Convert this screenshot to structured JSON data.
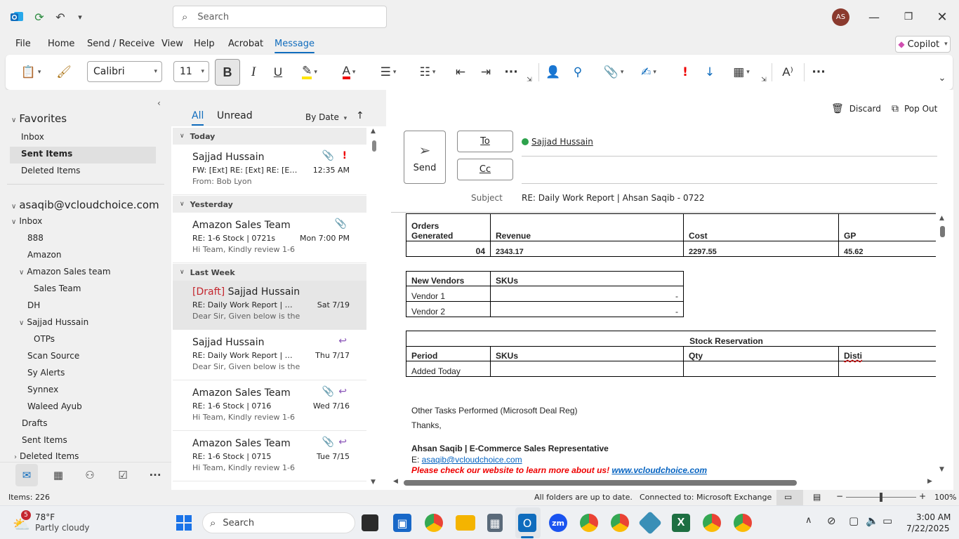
{
  "titlebar": {
    "search_placeholder": "Search",
    "avatar_initials": "AS"
  },
  "menu": {
    "file": "File",
    "home": "Home",
    "send_receive": "Send / Receive",
    "view": "View",
    "help": "Help",
    "acrobat": "Acrobat",
    "message": "Message",
    "copilot": "Copilot"
  },
  "ribbon": {
    "font": "Calibri",
    "size": "11"
  },
  "nav": {
    "favorites": "Favorites",
    "fav_items": [
      "Inbox",
      "Sent Items",
      "Deleted Items"
    ],
    "account": "asaqib@vcloudchoice.com",
    "inbox": "Inbox",
    "sub": [
      "888",
      "Amazon",
      "Amazon Sales team",
      "Sales Team",
      "DH",
      "Sajjad Hussain",
      "OTPs",
      "Scan Source",
      "Sy Alerts",
      "Synnex",
      "Waleed Ayub"
    ],
    "drafts": "Drafts",
    "sent": "Sent Items",
    "deleted": "Deleted Items"
  },
  "list": {
    "tab_all": "All",
    "tab_unread": "Unread",
    "sort": "By Date",
    "groups": [
      "Today",
      "Yesterday",
      "Last Week"
    ],
    "items": [
      {
        "sender": "Sajjad Hussain",
        "subject": "FW: [Ext] RE: [Ext] RE: [Ext] R...",
        "preview": "From: Bob Lyon",
        "date": "12:35 AM"
      },
      {
        "sender": "Amazon Sales Team",
        "subject": "RE: 1-6 Stock | 0721s",
        "preview": "Hi Team,  Kindly review 1-6",
        "date": "Mon 7:00 PM"
      },
      {
        "draft": "[Draft]",
        "sender": "Sajjad Hussain",
        "subject": "RE: Daily Work Report | Ah...",
        "preview": "Dear Sir,  Given below is the",
        "date": "Sat 7/19"
      },
      {
        "sender": "Sajjad Hussain",
        "subject": "RE: Daily Work Report | Ah...",
        "preview": "Dear Sir,  Given below is the",
        "date": "Thu 7/17"
      },
      {
        "sender": "Amazon Sales Team",
        "subject": "RE: 1-6 Stock | 0716",
        "preview": "Hi Team,  Kindly review 1-6",
        "date": "Wed 7/16"
      },
      {
        "sender": "Amazon Sales Team",
        "subject": "RE: 1-6 Stock | 0715",
        "preview": "Hi Team,  Kindly review 1-6",
        "date": "Tue 7/15"
      }
    ]
  },
  "compose": {
    "discard": "Discard",
    "popout": "Pop Out",
    "send": "Send",
    "to": "To",
    "cc": "Cc",
    "to_recipient": "Sajjad Hussain",
    "subject_label": "Subject",
    "subject": "RE: Daily Work Report | Ahsan Saqib - 0722"
  },
  "body": {
    "t1": {
      "h1a": "Orders",
      "h1b": "Generated",
      "h2": "Revenue",
      "h3": "Cost",
      "h4": "GP",
      "v1": "04",
      "v2": "2343.17",
      "v3": "2297.55",
      "v4": "45.62"
    },
    "t2": {
      "h1": "New Vendors",
      "h2": "SKUs",
      "rows": [
        {
          "name": "Vendor 1",
          "val": "-"
        },
        {
          "name": "Vendor 2",
          "val": "-"
        }
      ]
    },
    "t3": {
      "title": "Stock Reservation",
      "h1": "Period",
      "h2": "SKUs",
      "h3": "Qty",
      "h4": "Disti",
      "r1": "Added Today"
    },
    "other": "Other Tasks Performed (Microsoft Deal Reg)",
    "thanks": "Thanks,",
    "sig_name": "Ahsan Saqib | E-Commerce Sales Representative",
    "sig_email_label": "E: ",
    "sig_email": "asaqib@vcloudchoice.com",
    "sig_web_text": "Please check our website to learn more about us! ",
    "sig_web": "www.vcloudchoice.com"
  },
  "status": {
    "items": "Items: 226",
    "folders": "All folders are up to date.",
    "connected": "Connected to: Microsoft Exchange",
    "zoom": "100%"
  },
  "taskbar": {
    "weather_temp": "78°F",
    "weather_desc": "Partly cloudy",
    "weather_badge": "5",
    "search": "Search",
    "time": "3:00 AM",
    "date": "7/22/2025"
  }
}
